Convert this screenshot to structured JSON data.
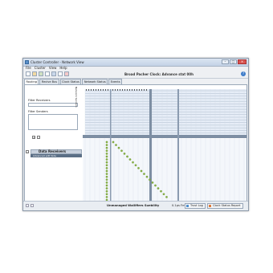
{
  "window": {
    "title": "Cluster Controller - Network View"
  },
  "menu": [
    "File",
    "Cluster",
    "View",
    "Help"
  ],
  "toolbar": {
    "clock": "Broad Pacher Clock: Advance stat 00h"
  },
  "tabs": [
    "Routing",
    "Recive Bus",
    "Clock Status",
    "Network Status",
    "Events"
  ],
  "left_panel": {
    "filter_label_1": "Filter Receivers",
    "filter_label_2": "Filter Senders",
    "header": "Data Receivers",
    "subheader": "Advanced edit Side",
    "side_label": "Network Senders"
  },
  "grid": {
    "top_bank_rows": 16,
    "main_diagonal_dots": 20,
    "left_column_dots": 21
  },
  "status": {
    "text": "Unmanaged Wallifiers Suebility",
    "value": "0.1ps  Fmst log",
    "button_1": "Trust Log",
    "button_2": "Clock Status Report"
  },
  "colors": {
    "accent": "#8ab444",
    "grid_line": "#9fb0c3",
    "cell_bg": "#e6edf7",
    "header_band": "#7d8ea3"
  }
}
